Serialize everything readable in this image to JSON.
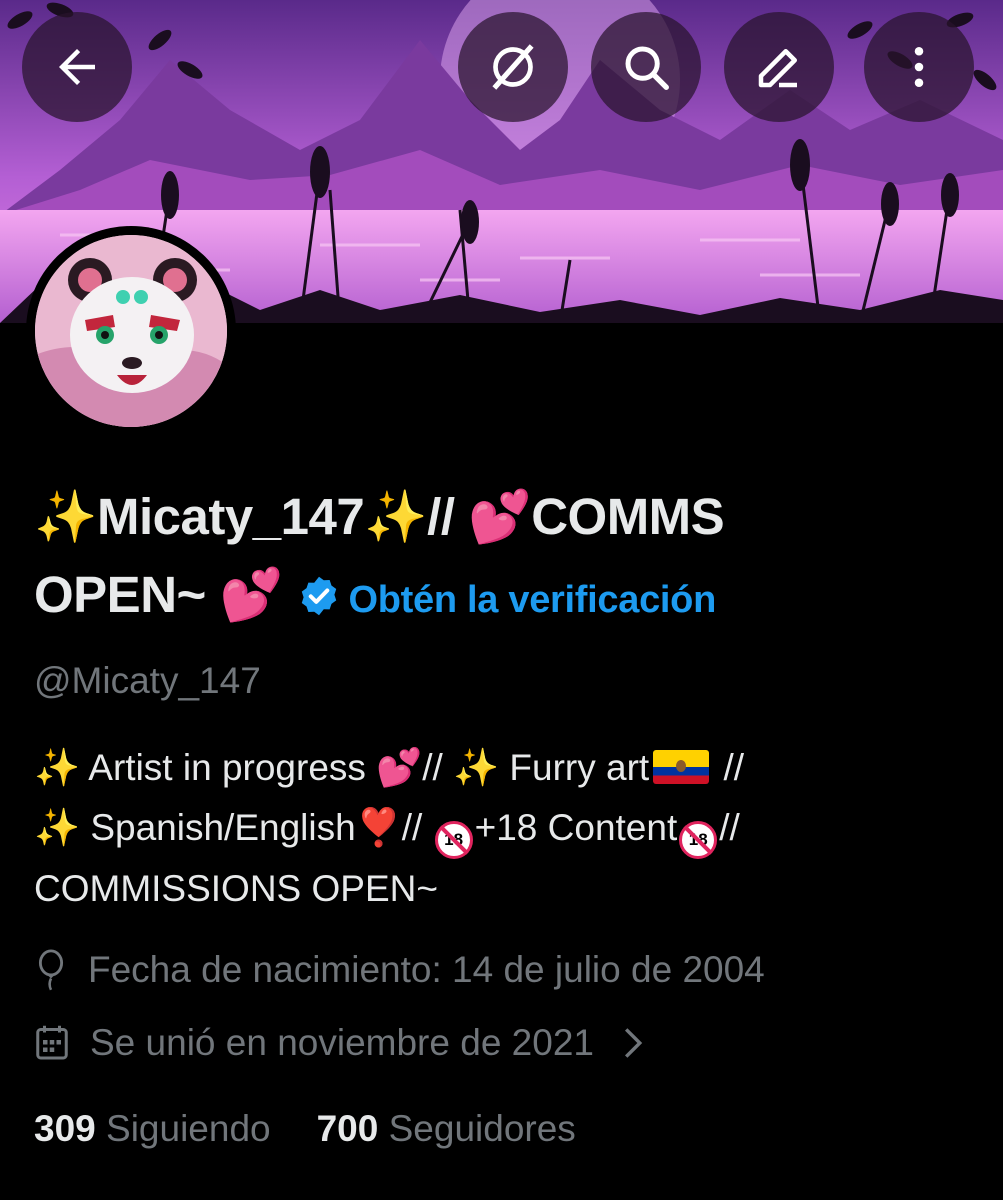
{
  "header": {
    "back_icon": "arrow-left-icon",
    "actions": [
      "no-translate-icon",
      "search-icon",
      "edit-icon",
      "more-vertical-icon"
    ]
  },
  "profile": {
    "name_line1": "✨Micaty_147✨// 💕COMMS",
    "name_line2": "OPEN~ 💕",
    "verify_link": "Obtén la verificación",
    "handle": "@Micaty_147",
    "bio": {
      "line1_a": "✨ Artist in progress 💕// ✨ Furry art",
      "line1_b": " //",
      "line2_a": "✨ Spanish/English❣️// ",
      "line2_b": "+18 Content",
      "line2_c": "//",
      "line3": "COMMISSIONS OPEN~"
    },
    "birthdate": "Fecha de nacimiento: 14 de julio de 2004",
    "joined": "Se unió en noviembre de 2021",
    "following_count": "309",
    "following_label": "Siguiendo",
    "followers_count": "700",
    "followers_label": "Seguidores"
  },
  "colors": {
    "background": "#000000",
    "accent": "#1d9bf0",
    "muted": "#71767b",
    "text": "#e7e9ea",
    "banner_sky": "#b35ad2",
    "banner_water": "#e27ce0"
  }
}
